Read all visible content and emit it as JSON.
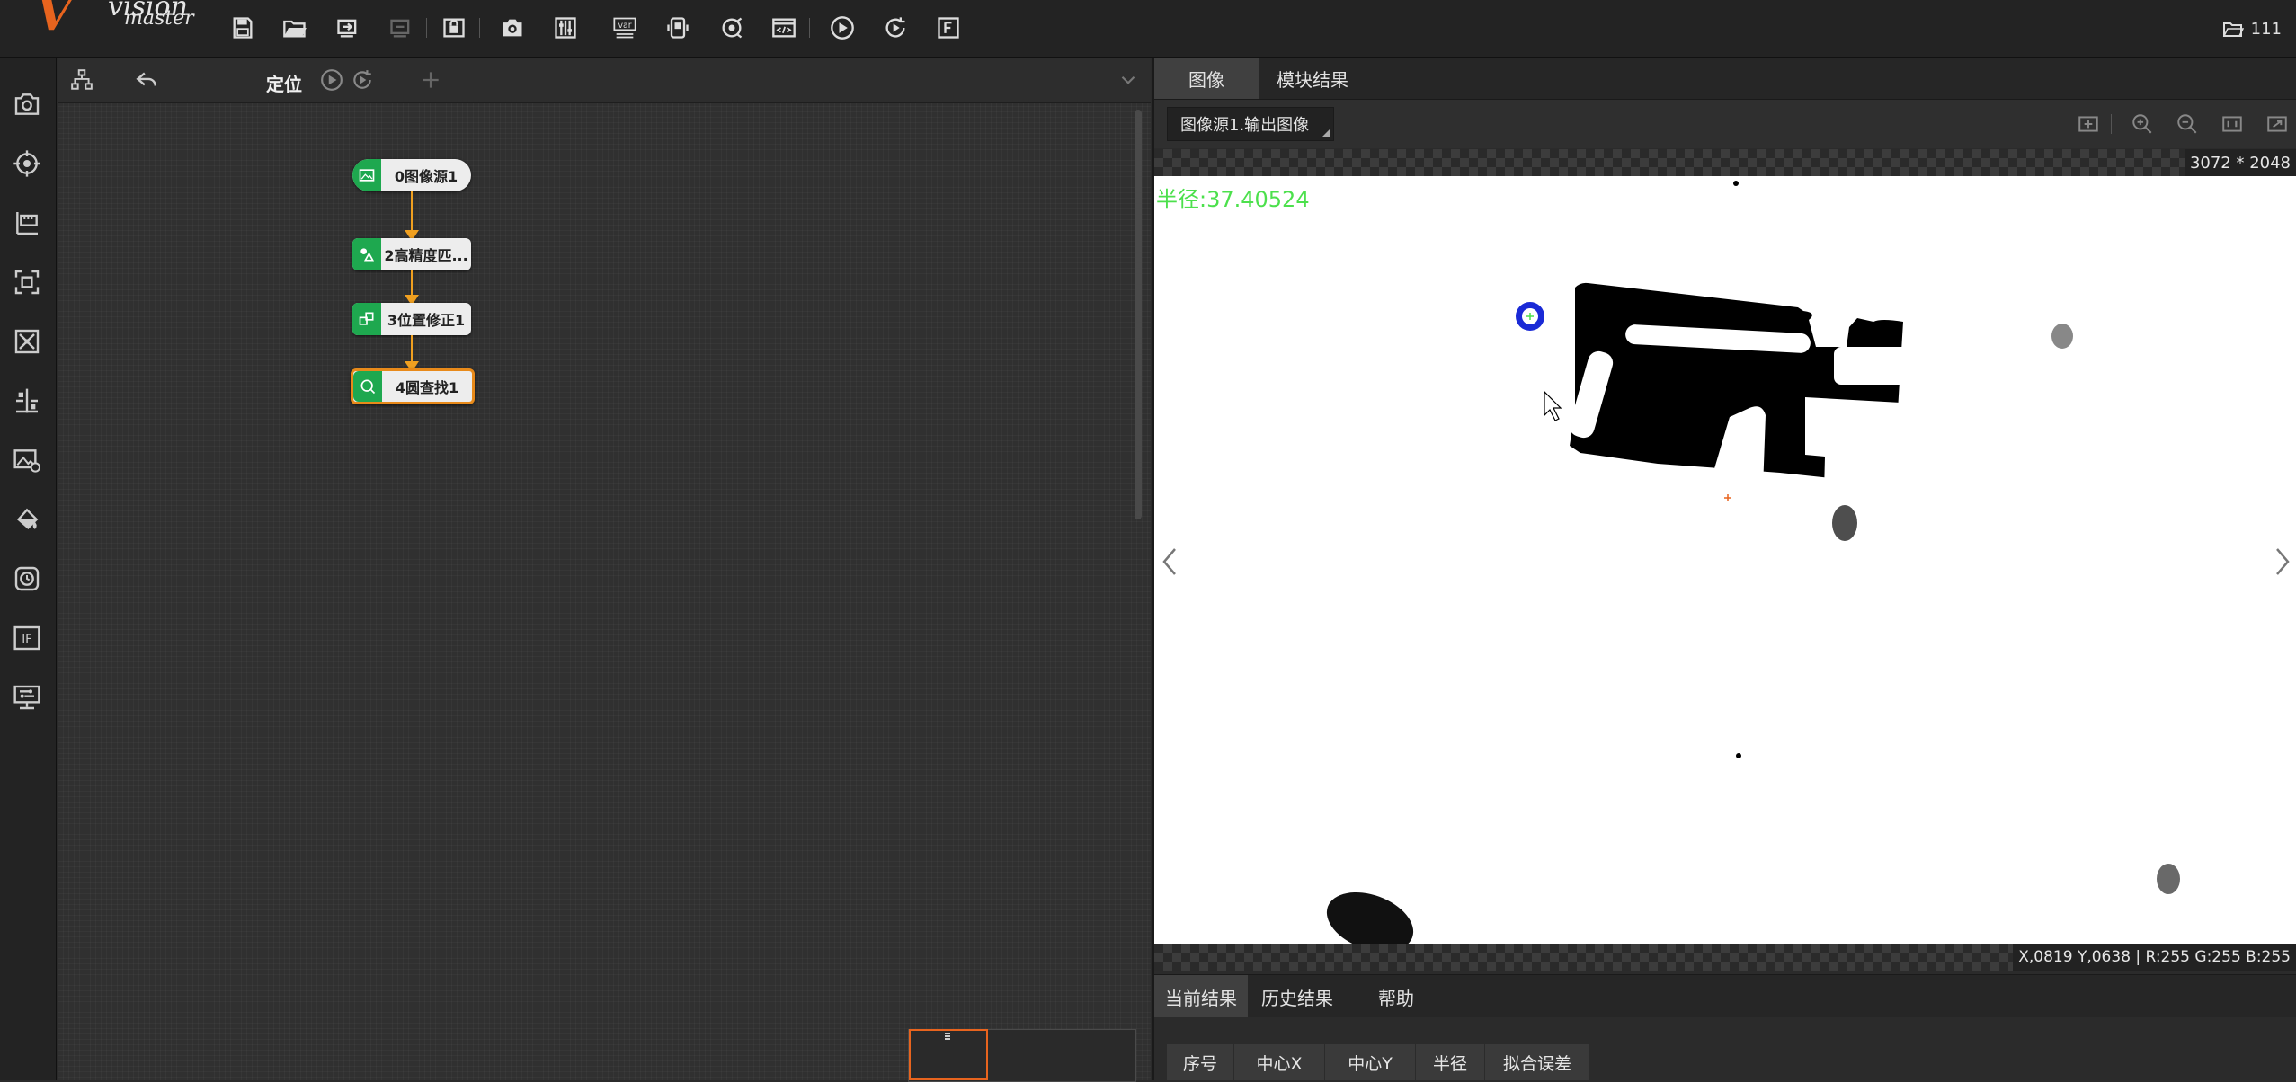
{
  "app": {
    "logo_letter": "V",
    "logo_line1": "vision",
    "logo_line2": "master",
    "top_right_label": "111",
    "accent": "#e8641e"
  },
  "toolbar_icons": [
    "save-icon",
    "open-folder-icon",
    "save-as-icon",
    "export-icon",
    "lock-icon",
    "camera-icon",
    "controller-icon",
    "variable-icon",
    "device-icon",
    "communication-icon",
    "script-icon",
    "run-once-icon",
    "run-continuous-icon",
    "function-icon"
  ],
  "left_tools": [
    "image-capture-icon",
    "locate-icon",
    "measure-icon",
    "recognize-icon",
    "calibrate-icon",
    "align-icon",
    "image-process-icon",
    "color-process-icon",
    "defect-icon",
    "logic-if-icon",
    "communication-tool-icon"
  ],
  "flow": {
    "title": "定位",
    "nodes": [
      {
        "label": "0图像源1"
      },
      {
        "label": "2高精度匹..."
      },
      {
        "label": "3位置修正1"
      },
      {
        "label": "4圆查找1"
      }
    ]
  },
  "image_panel": {
    "tabs": [
      "图像",
      "模块结果"
    ],
    "active_tab": 0,
    "source_select": "图像源1.输出图像",
    "image_size": "3072 * 2048",
    "radius_overlay": "半径:37.40524",
    "overlay_color": "#4ce04c",
    "coords": "X,0819  Y,0638  |  R:255  G:255  B:255"
  },
  "results": {
    "tabs": [
      "当前结果",
      "历史结果",
      "帮助"
    ],
    "active_tab": 0,
    "columns": [
      "序号",
      "中心X",
      "中心Y",
      "半径",
      "拟合误差"
    ]
  }
}
